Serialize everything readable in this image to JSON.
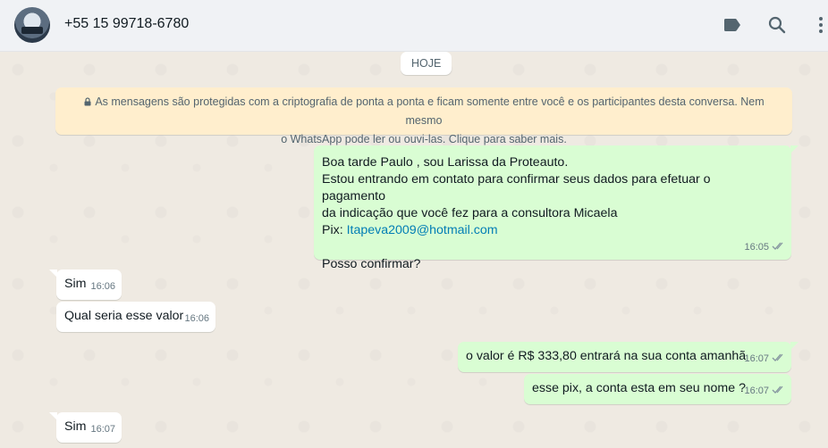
{
  "header": {
    "contact_name": "+55 15 99718-6780",
    "icons": [
      "label-icon",
      "search-icon",
      "menu-icon"
    ]
  },
  "chat": {
    "date_label": "HOJE",
    "encryption_notice_line1": "As mensagens são protegidas com a criptografia de ponta a ponta e ficam somente entre você e os participantes desta conversa. Nem mesmo",
    "encryption_notice_line2": "o WhatsApp pode ler ou ouvi-las. Clique para saber mais.",
    "messages": [
      {
        "direction": "out",
        "lines": [
          "Boa tarde Paulo , sou Larissa da Proteauto.",
          "Estou entrando em contato para confirmar seus dados para efetuar o pagamento",
          "da indicação que você fez para a consultora Micaela"
        ],
        "pix_label": "Pix: ",
        "pix_email": "Itapeva2009@hotmail.com",
        "closing": "Posso confirmar?",
        "time": "16:05",
        "status": "read"
      },
      {
        "direction": "in",
        "text": "Sim",
        "time": "16:06"
      },
      {
        "direction": "in",
        "text": "Qual seria esse valor",
        "time": "16:06"
      },
      {
        "direction": "out",
        "text": "o valor é R$ 333,80 entrará na sua conta amanhã",
        "time": "16:07",
        "status": "read"
      },
      {
        "direction": "out",
        "text": "esse pix, a conta esta em seu nome ?",
        "time": "16:07",
        "status": "read"
      },
      {
        "direction": "in",
        "text": "Sim",
        "time": "16:07"
      }
    ]
  },
  "colors": {
    "outgoing_bubble": "#d9fdd3",
    "incoming_bubble": "#ffffff",
    "chat_background": "#efeae2",
    "notice_background": "#ffeecd",
    "link": "#027eb5",
    "read_ticks": "#8696a0"
  }
}
